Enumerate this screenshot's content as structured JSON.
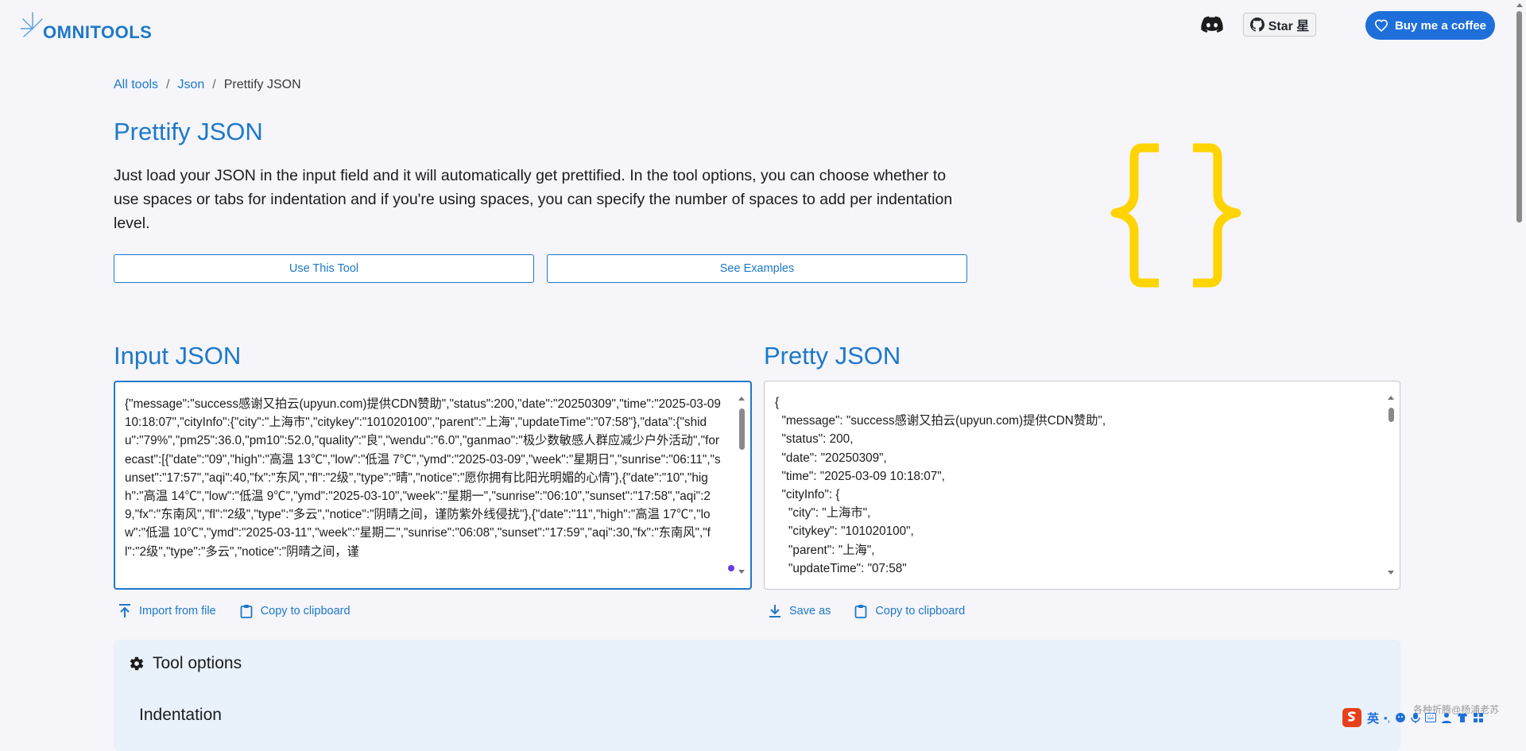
{
  "header": {
    "logo_text": "OMNITOOLS",
    "discord_icon": "discord-icon",
    "star_label": "Star 星",
    "coffee_label": "Buy me a coffee"
  },
  "breadcrumb": {
    "items": [
      "All tools",
      "Json",
      "Prettify JSON"
    ],
    "separator": "/"
  },
  "tool": {
    "title": "Prettify JSON",
    "description": "Just load your JSON in the input field and it will automatically get prettified. In the tool options, you can choose whether to use spaces or tabs for indentation and if you're using spaces, you can specify the number of spaces to add per indentation level.",
    "use_button": "Use This Tool",
    "examples_button": "See Examples",
    "icon": "braces-icon",
    "icon_color": "#ffd400"
  },
  "input": {
    "title": "Input JSON",
    "text": "{\"message\":\"success感谢又拍云(upyun.com)提供CDN赞助\",\"status\":200,\"date\":\"20250309\",\"time\":\"2025-03-09 10:18:07\",\"cityInfo\":{\"city\":\"上海市\",\"citykey\":\"101020100\",\"parent\":\"上海\",\"updateTime\":\"07:58\"},\"data\":{\"shidu\":\"79%\",\"pm25\":36.0,\"pm10\":52.0,\"quality\":\"良\",\"wendu\":\"6.0\",\"ganmao\":\"极少数敏感人群应减少户外活动\",\"forecast\":[{\"date\":\"09\",\"high\":\"高温 13℃\",\"low\":\"低温 7℃\",\"ymd\":\"2025-03-09\",\"week\":\"星期日\",\"sunrise\":\"06:11\",\"sunset\":\"17:57\",\"aqi\":40,\"fx\":\"东风\",\"fl\":\"2级\",\"type\":\"晴\",\"notice\":\"愿你拥有比阳光明媚的心情\"},{\"date\":\"10\",\"high\":\"高温 14℃\",\"low\":\"低温 9℃\",\"ymd\":\"2025-03-10\",\"week\":\"星期一\",\"sunrise\":\"06:10\",\"sunset\":\"17:58\",\"aqi\":29,\"fx\":\"东南风\",\"fl\":\"2级\",\"type\":\"多云\",\"notice\":\"阴晴之间，谨防紫外线侵扰\"},{\"date\":\"11\",\"high\":\"高温 17℃\",\"low\":\"低温 10℃\",\"ymd\":\"2025-03-11\",\"week\":\"星期二\",\"sunrise\":\"06:08\",\"sunset\":\"17:59\",\"aqi\":30,\"fx\":\"东南风\",\"fl\":\"2级\",\"type\":\"多云\",\"notice\":\"阴晴之间，谨",
    "import_label": "Import from file",
    "copy_label": "Copy to clipboard"
  },
  "output": {
    "title": "Pretty JSON",
    "text": "{\n  \"message\": \"success感谢又拍云(upyun.com)提供CDN赞助\",\n  \"status\": 200,\n  \"date\": \"20250309\",\n  \"time\": \"2025-03-09 10:18:07\",\n  \"cityInfo\": {\n    \"city\": \"上海市\",\n    \"citykey\": \"101020100\",\n    \"parent\": \"上海\",\n    \"updateTime\": \"07:58\"",
    "save_label": "Save as",
    "copy_label": "Copy to clipboard"
  },
  "options": {
    "title": "Tool options",
    "indentation_label": "Indentation"
  },
  "system": {
    "ime_label": "英",
    "watermark": "各种折腾@杨浦老苏"
  }
}
